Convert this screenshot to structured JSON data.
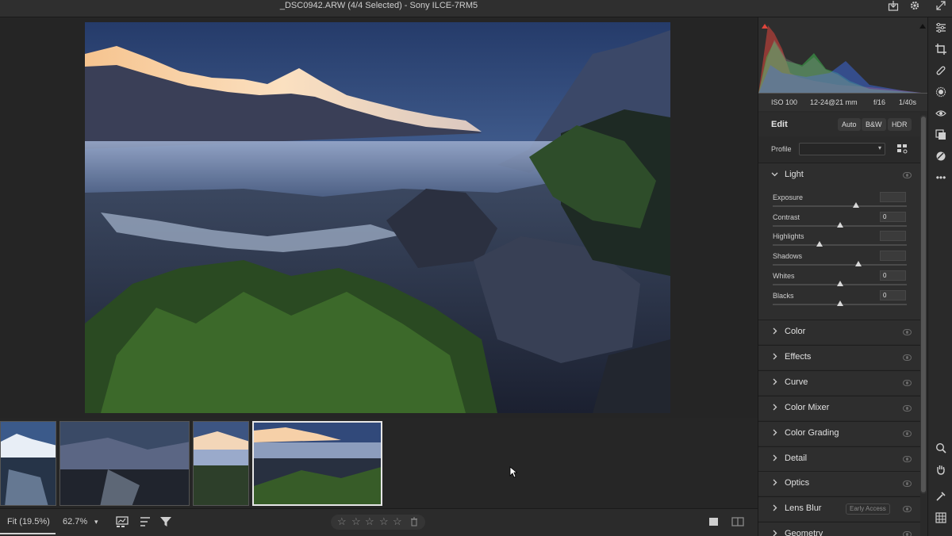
{
  "window": {
    "title": "_DSC0942.ARW (4/4 Selected)  -  Sony ILCE-7RM5"
  },
  "histogram": {
    "exif": {
      "iso": "ISO 100",
      "focal": "12-24@21 mm",
      "aperture": "f/16",
      "shutter": "1/40s"
    },
    "colors": {
      "red": "#e0453c",
      "green": "#3fbf4f",
      "blue": "#3d67d8"
    }
  },
  "edit": {
    "title": "Edit",
    "buttons": [
      "Auto",
      "B&W",
      "HDR"
    ],
    "profile_label": "Profile",
    "profile_value": ""
  },
  "light": {
    "label": "Light",
    "sliders": [
      {
        "label": "Exposure",
        "value": "",
        "position": 0.62
      },
      {
        "label": "Contrast",
        "value": "0",
        "position": 0.5
      },
      {
        "label": "Highlights",
        "value": "",
        "position": 0.35
      },
      {
        "label": "Shadows",
        "value": "",
        "position": 0.64
      },
      {
        "label": "Whites",
        "value": "0",
        "position": 0.5
      },
      {
        "label": "Blacks",
        "value": "0",
        "position": 0.5
      }
    ]
  },
  "sections": [
    {
      "label": "Color"
    },
    {
      "label": "Effects"
    },
    {
      "label": "Curve"
    },
    {
      "label": "Color Mixer"
    },
    {
      "label": "Color Grading"
    },
    {
      "label": "Detail"
    },
    {
      "label": "Optics"
    },
    {
      "label": "Lens Blur",
      "badge": "Early Access"
    },
    {
      "label": "Geometry"
    }
  ],
  "bottom": {
    "fit": "Fit (19.5%)",
    "zoom": "62.7%",
    "stars": [
      "☆",
      "☆",
      "☆",
      "☆",
      "☆"
    ]
  },
  "filmstrip": {
    "count": 4,
    "selected_index": 3
  },
  "icons": {
    "top": [
      "export-icon",
      "settings-gear-icon",
      "expand-icon"
    ],
    "tools": [
      "edit-sliders-icon",
      "crop-icon",
      "healing-icon",
      "masking-icon",
      "red-eye-icon",
      "presets-icon",
      "remove-icon",
      "more-icon",
      "zoom-icon",
      "hand-icon",
      "sampler-icon",
      "grid-icon"
    ]
  }
}
